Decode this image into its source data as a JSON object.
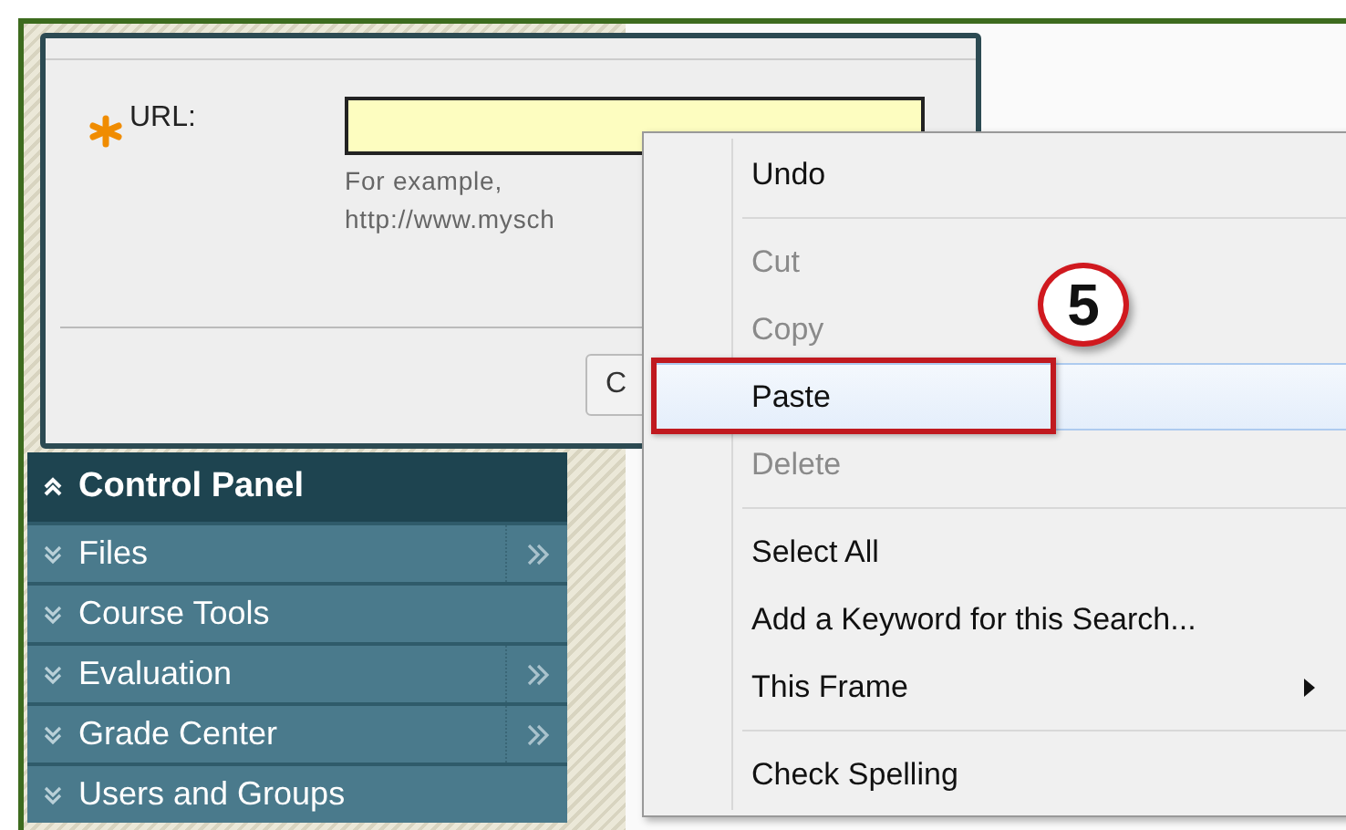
{
  "dialog": {
    "field": {
      "label": "URL:",
      "required": true,
      "hint_lines": [
        "For example,",
        "http://www.mysch"
      ]
    },
    "button": "C"
  },
  "control_panel": {
    "title": "Control Panel",
    "items": [
      {
        "label": "Files",
        "has_flyout": true
      },
      {
        "label": "Course Tools",
        "has_flyout": false
      },
      {
        "label": "Evaluation",
        "has_flyout": true
      },
      {
        "label": "Grade Center",
        "has_flyout": true
      },
      {
        "label": "Users and Groups",
        "has_flyout": false
      }
    ]
  },
  "context_menu": {
    "items": [
      {
        "kind": "item",
        "label": "Undo",
        "disabled": false,
        "selected": false,
        "outlined": false,
        "submenu": false
      },
      {
        "kind": "separator"
      },
      {
        "kind": "item",
        "label": "Cut",
        "disabled": true,
        "selected": false,
        "outlined": false,
        "submenu": false
      },
      {
        "kind": "item",
        "label": "Copy",
        "disabled": true,
        "selected": false,
        "outlined": false,
        "submenu": false
      },
      {
        "kind": "item",
        "label": "Paste",
        "disabled": false,
        "selected": true,
        "outlined": true,
        "submenu": false
      },
      {
        "kind": "item",
        "label": "Delete",
        "disabled": true,
        "selected": false,
        "outlined": false,
        "submenu": false
      },
      {
        "kind": "separator"
      },
      {
        "kind": "item",
        "label": "Select All",
        "disabled": false,
        "selected": false,
        "outlined": false,
        "submenu": false
      },
      {
        "kind": "item",
        "label": "Add a Keyword for this Search...",
        "disabled": false,
        "selected": false,
        "outlined": false,
        "submenu": false
      },
      {
        "kind": "item",
        "label": "This Frame",
        "disabled": false,
        "selected": false,
        "outlined": false,
        "submenu": true
      },
      {
        "kind": "separator"
      },
      {
        "kind": "item",
        "label": "Check Spelling",
        "disabled": false,
        "selected": false,
        "outlined": false,
        "submenu": false
      }
    ]
  },
  "step_callout": "5"
}
